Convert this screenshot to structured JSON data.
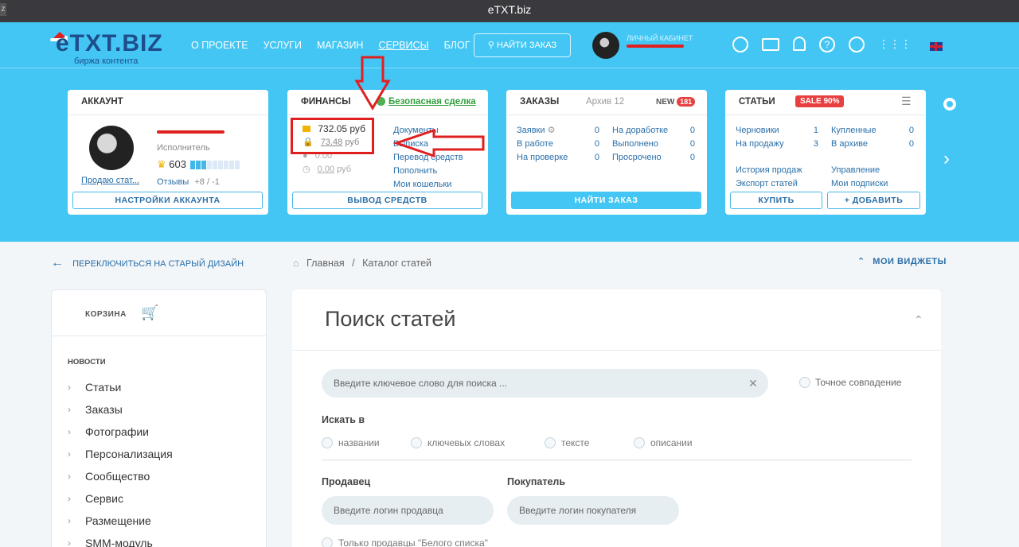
{
  "window": {
    "title": "eTXT.biz",
    "left_glyph": "z"
  },
  "header": {
    "logo": "eTXT.BIZ",
    "logo_sub": "биржа контента",
    "nav": [
      "О ПРОЕКТЕ",
      "УСЛУГИ",
      "МАГАЗИН",
      "СЕРВИСЫ",
      "БЛОГ"
    ],
    "find_order": "НАЙТИ ЗАКАЗ",
    "cabinet_label": "ЛИЧНЫЙ КАБИНЕТ",
    "icons": [
      "search-icon",
      "mail-icon",
      "bell-icon",
      "help-icon",
      "headset-icon",
      "grid-icon"
    ]
  },
  "account": {
    "title": "АККАУНТ",
    "role": "Исполнитель",
    "rating": "603",
    "rating_level": "3 of 9",
    "sell_link": "Продаю стат...",
    "reviews": "Отзывы",
    "reviews_count": "+8 / -1",
    "button": "НАСТРОЙКИ АККАУНТА"
  },
  "finance": {
    "title": "ФИНАНСЫ",
    "safe_deal": "Безопасная сделка",
    "balance": "732.05",
    "balance_unit": "руб",
    "locked": "73.48",
    "locked_unit": "руб",
    "zero1": "0.00",
    "zero2": "0.00",
    "zero2_unit": "руб",
    "links": [
      "Документы",
      "Выписка",
      "Перевод средств",
      "Пополнить",
      "Мои кошельки"
    ],
    "button": "ВЫВОД СРЕДСТВ"
  },
  "orders": {
    "title": "ЗАКАЗЫ",
    "archive": "Архив 12",
    "new_label": "NEW",
    "new_count": "181",
    "left": [
      {
        "label": "Заявки",
        "value": "0"
      },
      {
        "label": "В работе",
        "value": "0"
      },
      {
        "label": "На проверке",
        "value": "0"
      }
    ],
    "right": [
      {
        "label": "На доработке",
        "value": "0"
      },
      {
        "label": "Выполнено",
        "value": "0"
      },
      {
        "label": "Просрочено",
        "value": "0"
      }
    ],
    "button": "НАЙТИ ЗАКАЗ"
  },
  "articles": {
    "title": "СТАТЬИ",
    "sale": "SALE 90%",
    "left": [
      {
        "label": "Черновики",
        "value": "1"
      },
      {
        "label": "На продажу",
        "value": "3"
      }
    ],
    "right": [
      {
        "label": "Купленные",
        "value": "0"
      },
      {
        "label": "В архиве",
        "value": "0"
      }
    ],
    "links_left": [
      "История продаж",
      "Экспорт статей"
    ],
    "links_right": [
      "Управление",
      "Мои подписки"
    ],
    "buy": "КУПИТЬ",
    "add": "+ ДОБАВИТЬ"
  },
  "subbar": {
    "switch": "ПЕРЕКЛЮЧИТЬСЯ НА СТАРЫЙ ДИЗАЙН",
    "crumb_home": "Главная",
    "crumb_sep": "/",
    "crumb_current": "Каталог статей",
    "widgets": "МОИ ВИДЖЕТЫ"
  },
  "sidebar": {
    "cart": "КОРЗИНА",
    "news": "НОВОСТИ",
    "items": [
      "Статьи",
      "Заказы",
      "Фотографии",
      "Персонализация",
      "Сообщество",
      "Сервис",
      "Размещение",
      "SMM-модуль"
    ]
  },
  "search_panel": {
    "title": "Поиск статей",
    "placeholder": "Введите ключевое слово для поиска ...",
    "exact": "Точное совпадение",
    "search_in": "Искать в",
    "options": [
      "названии",
      "ключевых словах",
      "тексте",
      "описании"
    ],
    "seller_label": "Продавец",
    "seller_placeholder": "Введите логин продавца",
    "buyer_label": "Покупатель",
    "buyer_placeholder": "Введите логин покупателя",
    "white_list": "Только продавцы \"Белого списка\""
  }
}
